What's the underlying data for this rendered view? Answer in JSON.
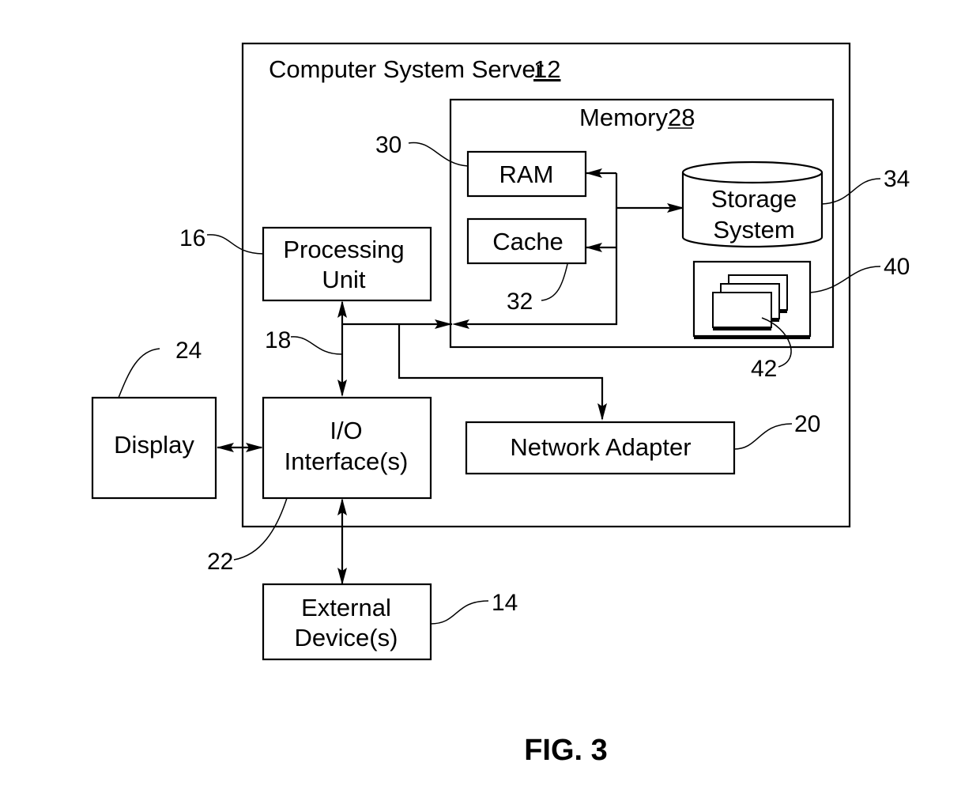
{
  "figure": {
    "caption": "FIG. 3",
    "server": {
      "title": "Computer System Server",
      "ref": "12"
    },
    "memory": {
      "title": "Memory",
      "ref": "28"
    },
    "blocks": {
      "ram": {
        "label": "RAM",
        "ref": "30"
      },
      "cache": {
        "label": "Cache",
        "ref": "32"
      },
      "storage": {
        "line1": "Storage",
        "line2": "System",
        "ref": "34"
      },
      "program_module_group": {
        "ref": "40"
      },
      "program_modules": {
        "ref": "42"
      },
      "processing_unit": {
        "line1": "Processing",
        "line2": "Unit",
        "ref": "16"
      },
      "bus": {
        "ref": "18"
      },
      "io_interface": {
        "line1": "I/O",
        "line2": "Interface(s)",
        "ref": "22"
      },
      "network_adapter": {
        "label": "Network Adapter",
        "ref": "20"
      },
      "display": {
        "label": "Display",
        "ref": "24"
      },
      "external_devices": {
        "line1": "External",
        "line2": "Device(s)",
        "ref": "14"
      }
    }
  }
}
